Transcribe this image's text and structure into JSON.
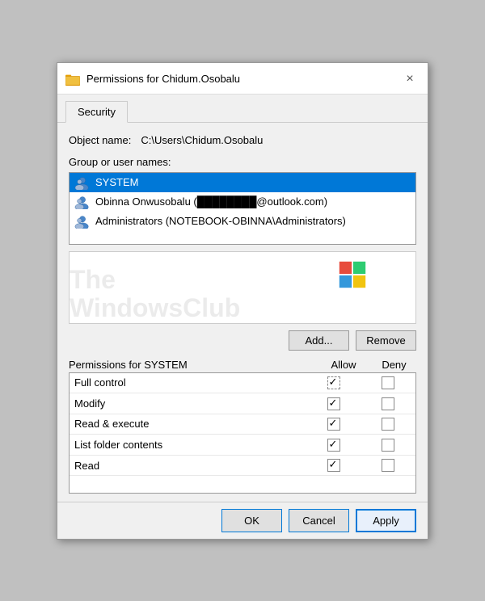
{
  "dialog": {
    "title": "Permissions for Chidum.Osobalu",
    "close_label": "×"
  },
  "tabs": [
    {
      "label": "Security",
      "active": true
    }
  ],
  "object_name": {
    "label": "Object name:",
    "value": "C:\\Users\\Chidum.Osobalu"
  },
  "group_label": "Group or user names:",
  "users": [
    {
      "name": "SYSTEM",
      "selected": true
    },
    {
      "name": "Obinna Onwusobalu (████████@outlook.com)",
      "selected": false
    },
    {
      "name": "Administrators (NOTEBOOK-OBINNA\\Administrators)",
      "selected": false
    }
  ],
  "buttons": {
    "add": "Add...",
    "remove": "Remove"
  },
  "permissions_header": {
    "label_prefix": "Permissions for ",
    "subject": "SYSTEM",
    "allow": "Allow",
    "deny": "Deny"
  },
  "permissions": [
    {
      "name": "Full control",
      "allow": true,
      "allow_dotted": true,
      "deny": false
    },
    {
      "name": "Modify",
      "allow": true,
      "allow_dotted": false,
      "deny": false
    },
    {
      "name": "Read & execute",
      "allow": true,
      "allow_dotted": false,
      "deny": false
    },
    {
      "name": "List folder contents",
      "allow": true,
      "allow_dotted": false,
      "deny": false
    },
    {
      "name": "Read",
      "allow": true,
      "allow_dotted": false,
      "deny": false
    }
  ],
  "footer": {
    "ok": "OK",
    "cancel": "Cancel",
    "apply": "Apply"
  },
  "watermark": {
    "line1": "The",
    "line2": "WindowsClub"
  }
}
